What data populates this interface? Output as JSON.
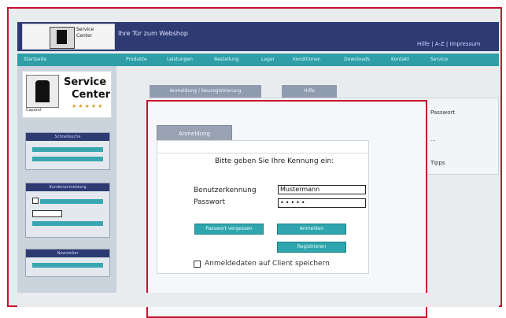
{
  "header": {
    "title": "Ihre Tür zum Webshop",
    "user_info": "Hilfe | A-Z | Impressum",
    "logo_small_text": [
      "Service",
      "Center"
    ]
  },
  "nav": {
    "left_label": "Startseite",
    "items": [
      "Produkte",
      "Leistungen",
      "Bestellung",
      "Lager",
      "Konditionen",
      "Downloads",
      "Kontakt",
      "Service"
    ]
  },
  "sidebar": {
    "brand_name": "Caparol",
    "logo_service": "Service",
    "logo_center": "Center",
    "logo_stars": "★★★★★",
    "boxes": [
      {
        "title": "Schnellsuche"
      },
      {
        "title": "Kundenanmeldung"
      },
      {
        "title": "Newsletter"
      }
    ]
  },
  "content": {
    "tabs": [
      "Anmeldung / Neuregistrierung",
      "Hilfe"
    ],
    "bg_texts": [
      "Passwort",
      "...",
      "Tipps"
    ]
  },
  "dialog": {
    "tab_label": "Anmeldung",
    "prompt": "Bitte geben Sie Ihre Kennung ein:",
    "username_label": "Benutzerkennung",
    "password_label": "Passwort",
    "username_value": "Mustermann",
    "password_value": "•••••",
    "buttons": {
      "forgot": "Passwort vergessen",
      "login": "Anmelden",
      "register": "Registrieren"
    },
    "remember_label": "Anmeldedaten auf Client speichern"
  }
}
